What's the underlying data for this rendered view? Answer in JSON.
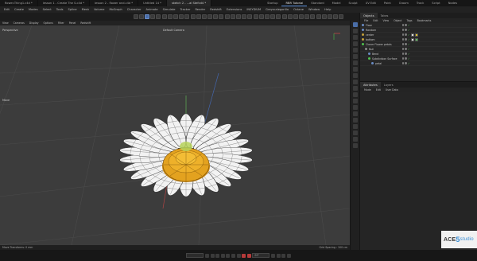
{
  "tabbar": {
    "docs": [
      {
        "label": "flower-Thing1.c4d *",
        "active": false
      },
      {
        "label": "lesson 1 - Create The S.c4d *",
        "active": false
      },
      {
        "label": "lesson 2 - flower and.c4d *",
        "active": false
      },
      {
        "label": "Untitled 14 *",
        "active": false
      },
      {
        "label": "sketch 2 - ...ai Stefcd4 *",
        "active": true
      }
    ],
    "layouts": [
      {
        "label": "Startup",
        "active": false
      },
      {
        "label": "RBR Tutorial",
        "active": true
      },
      {
        "label": "Standard",
        "active": false
      },
      {
        "label": "Model",
        "active": false
      },
      {
        "label": "Sculpt",
        "active": false
      },
      {
        "label": "UV Edit",
        "active": false
      },
      {
        "label": "Paint",
        "active": false
      },
      {
        "label": "Groom",
        "active": false
      },
      {
        "label": "Track",
        "active": false
      },
      {
        "label": "Script",
        "active": false
      },
      {
        "label": "Nodes",
        "active": false
      }
    ]
  },
  "menubar": {
    "items": [
      "Edit",
      "Create",
      "Modes",
      "Select",
      "Tools",
      "Spline",
      "Mesh",
      "Volume",
      "MoGraph",
      "Character",
      "Animate",
      "Simulate",
      "Tracker",
      "Render",
      "Redshift",
      "Extensions",
      "INSYDIUM",
      "Greyscalegorilla",
      "Octane",
      "Window",
      "Help"
    ]
  },
  "viewport": {
    "menu": [
      "View",
      "Cameras",
      "Display",
      "Options",
      "Filter",
      "Panel",
      "Redshift"
    ],
    "label_left": "Perspective",
    "label_center": "Default Camera",
    "move_label": "Move",
    "status_left": "Move Transforms: 0 mm",
    "status_right": "Grid Spacing : 100 cm"
  },
  "objects_panel": {
    "tabs": [
      {
        "label": "Objects",
        "active": true
      },
      {
        "label": "Takes",
        "active": false
      }
    ],
    "menu": [
      "File",
      "Edit",
      "View",
      "Object",
      "Tags",
      "Bookmarks"
    ],
    "rows": [
      {
        "name": "Floor",
        "indent": 0,
        "color": "#6a8cc4"
      },
      {
        "name": "Random",
        "indent": 0,
        "color": "#6a8cc4"
      },
      {
        "name": "center",
        "indent": 0,
        "color": "#c4a03a"
      },
      {
        "name": "bottom",
        "indent": 0,
        "color": "#c4a03a"
      },
      {
        "name": "Cloner Flower petals",
        "indent": 0,
        "color": "#4fc24f"
      },
      {
        "name": "Null",
        "indent": 1,
        "color": "#8a8a8a"
      },
      {
        "name": "Bend",
        "indent": 2,
        "color": "#6a8cc4"
      },
      {
        "name": "Subdivision Surface",
        "indent": 2,
        "color": "#4fc24f"
      },
      {
        "name": "petal",
        "indent": 3,
        "color": "#6a8cc4"
      }
    ]
  },
  "attributes_panel": {
    "tabs": [
      {
        "label": "Attributes",
        "active": true
      },
      {
        "label": "Layers",
        "active": false
      }
    ],
    "menu": [
      "Mode",
      "Edit",
      "User Data"
    ]
  },
  "timeline": {
    "frame": "0 F"
  },
  "watermark": {
    "text_a": "ACE",
    "text_b": "5",
    "text_c": "studio"
  },
  "colors": {
    "accent": "#5b8fd9",
    "petal": "#f2f2f2",
    "center": "#e0a020",
    "check": "#4fc24f"
  }
}
